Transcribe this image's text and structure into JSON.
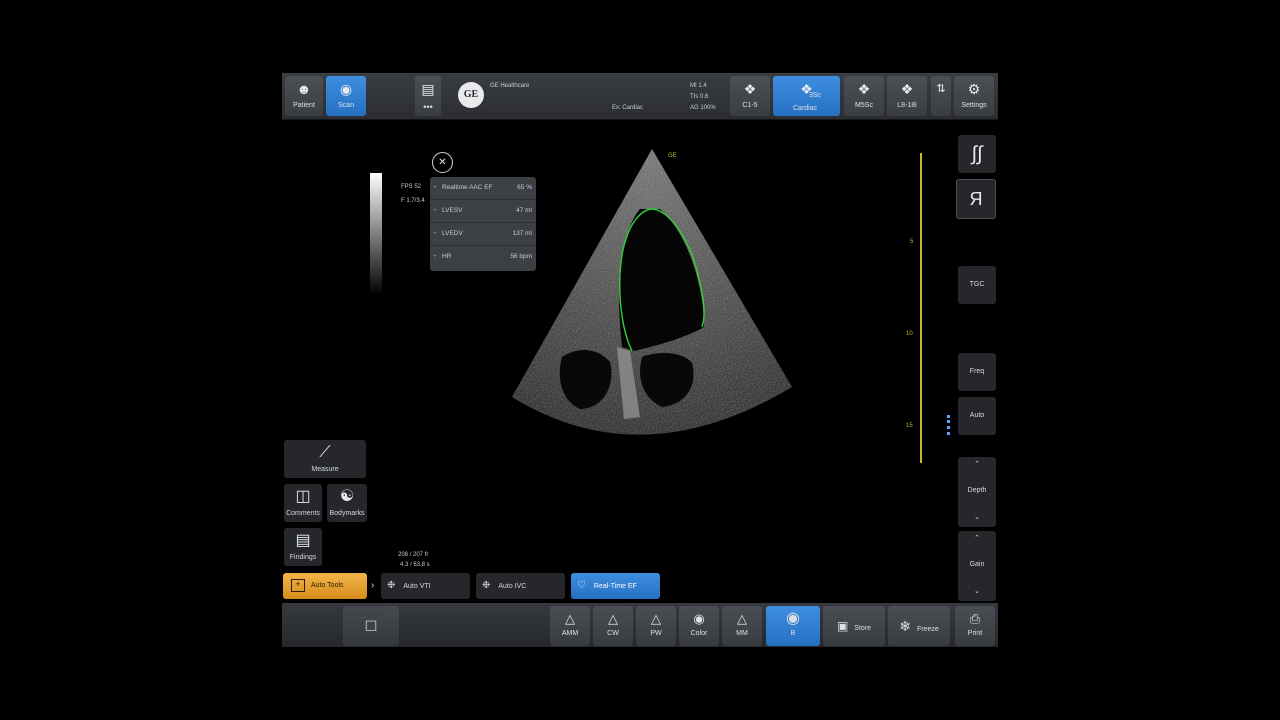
{
  "topbar": {
    "patient_label": "Patient",
    "scan_label": "Scan",
    "brand": "GE Healthcare",
    "exam": "Ex: Cardiac",
    "mi": "MI 1.4",
    "tis": "TIs 0.6",
    "ag": "AG 100%",
    "probes": [
      "C1-5",
      "3Sc",
      "M5Sc",
      "L8-18i"
    ],
    "probe_sub": [
      "",
      "Cardiac",
      "",
      ""
    ],
    "active_probe_index": 1,
    "settings_label": "Settings"
  },
  "image_info": {
    "fps": "FPS 52",
    "line2": "F 1.7/3.4",
    "scale_marks": [
      "5",
      "10",
      "15"
    ]
  },
  "measurements": [
    {
      "label": "Realtime AAC EF",
      "value": "65 %"
    },
    {
      "label": "LVESV",
      "value": "47 ml"
    },
    {
      "label": "LVEDV",
      "value": "137 ml"
    },
    {
      "label": "HR",
      "value": "56 bpm"
    }
  ],
  "side_controls": {
    "tgc": "TGC",
    "freq": "Freq",
    "auto": "Auto",
    "depth": "Depth",
    "gain": "Gain"
  },
  "left_tools": {
    "measure": "Measure",
    "comments": "Comments",
    "bodymarks": "Bodymarks",
    "findings": "Findings"
  },
  "frame_info": {
    "line1": "208 / 207 fr",
    "line2": "4.3 / 63.8 s"
  },
  "tools_row": {
    "auto_tools": "Auto Tools",
    "auto_vti": "Auto VTI",
    "auto_ivc": "Auto IVC",
    "real_time_ef": "Real-Time EF"
  },
  "bottombar": {
    "modes": [
      "AMM",
      "CW",
      "PW",
      "Color",
      "MM",
      "B"
    ],
    "active_mode": "B",
    "store": "Store",
    "freeze": "Freeze",
    "print": "Print"
  },
  "colors": {
    "accent_blue": "#2f80d8",
    "gold": "#e3a22f",
    "trace_green": "#2fd13c",
    "scale_yellow": "#c9b53a"
  }
}
